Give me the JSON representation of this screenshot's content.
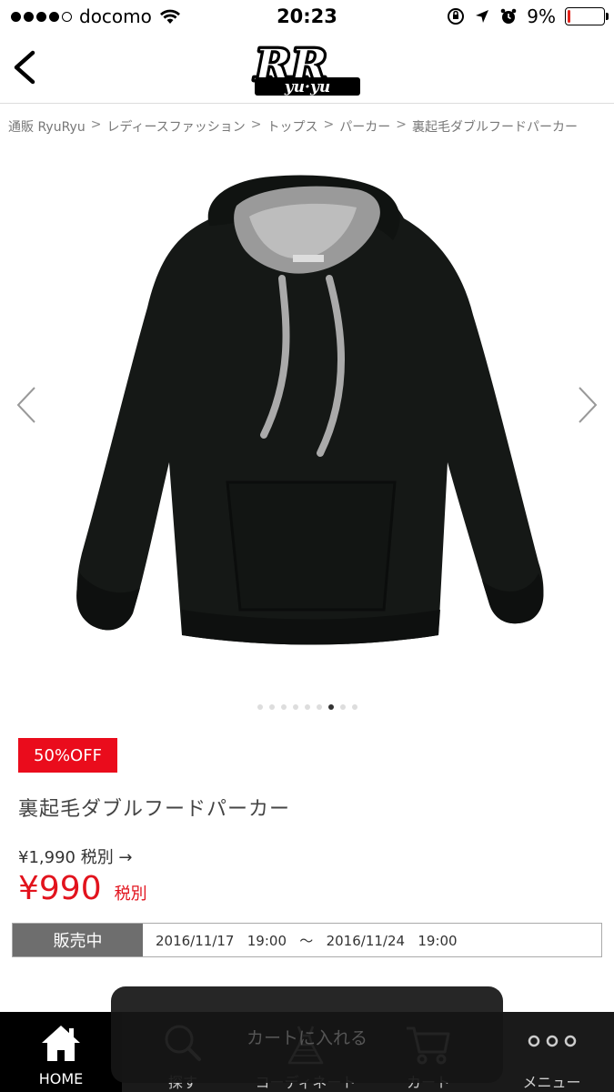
{
  "status_bar": {
    "carrier": "docomo",
    "time": "20:23",
    "battery_percent": "9%",
    "battery_level": 0.09
  },
  "header": {
    "logo_text": "RR",
    "logo_subtext": "yu·yu"
  },
  "breadcrumb": [
    "通販 RyuRyu",
    "レディースファッション",
    "トップス",
    "パーカー",
    "裏起毛ダブルフードパーカー"
  ],
  "breadcrumb_separator": ">",
  "gallery": {
    "image_count": 9,
    "active_index": 6
  },
  "product": {
    "badge": "50%OFF",
    "name": "裏起毛ダブルフードパーカー",
    "original_price": "¥1,990 税別 →",
    "sale_price": "¥990",
    "sale_tax": "税別"
  },
  "sale_period": {
    "label": "販売中",
    "text": "2016/11/17   19:00   〜   2016/11/24   19:00"
  },
  "cart_toast": {
    "label": "カートに入れる"
  },
  "bottom_nav": {
    "items": [
      {
        "label": "HOME",
        "icon": "home-icon"
      },
      {
        "label": "探す",
        "icon": "search-icon"
      },
      {
        "label": "コーディネート",
        "icon": "dress-icon"
      },
      {
        "label": "カート",
        "icon": "cart-icon"
      },
      {
        "label": "メニュー",
        "icon": "more-icon"
      }
    ]
  },
  "colors": {
    "accent_red": "#ea0c1c",
    "nav_background": "#1a1a1a"
  }
}
